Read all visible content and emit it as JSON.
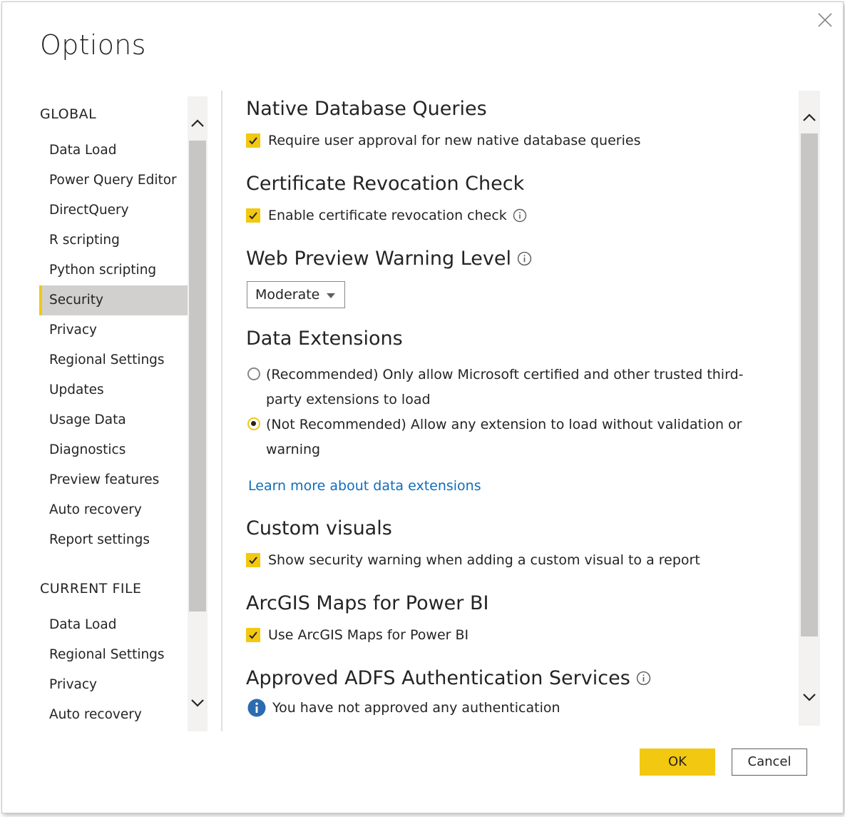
{
  "dialog": {
    "title": "Options",
    "ok_label": "OK",
    "cancel_label": "Cancel"
  },
  "nav": {
    "global_heading": "GLOBAL",
    "global_items": [
      {
        "label": "Data Load"
      },
      {
        "label": "Power Query Editor"
      },
      {
        "label": "DirectQuery"
      },
      {
        "label": "R scripting"
      },
      {
        "label": "Python scripting"
      },
      {
        "label": "Security",
        "selected": true
      },
      {
        "label": "Privacy"
      },
      {
        "label": "Regional Settings"
      },
      {
        "label": "Updates"
      },
      {
        "label": "Usage Data"
      },
      {
        "label": "Diagnostics"
      },
      {
        "label": "Preview features"
      },
      {
        "label": "Auto recovery"
      },
      {
        "label": "Report settings"
      }
    ],
    "current_heading": "CURRENT FILE",
    "current_items": [
      {
        "label": "Data Load"
      },
      {
        "label": "Regional Settings"
      },
      {
        "label": "Privacy"
      },
      {
        "label": "Auto recovery"
      }
    ]
  },
  "security": {
    "native_queries": {
      "title": "Native Database Queries",
      "checkbox_label": "Require user approval for new native database queries",
      "checked": true
    },
    "cert_revocation": {
      "title": "Certificate Revocation Check",
      "checkbox_label": "Enable certificate revocation check",
      "checked": true
    },
    "web_preview": {
      "title": "Web Preview Warning Level",
      "selected_value": "Moderate"
    },
    "data_extensions": {
      "title": "Data Extensions",
      "option_recommended_line1": "(Recommended) Only allow Microsoft certified and other trusted third-",
      "option_recommended_line2": "party extensions to load",
      "option_not_recommended_line1": "(Not Recommended) Allow any extension to load without validation or",
      "option_not_recommended_line2": "warning",
      "selected": "not_recommended",
      "learn_more": "Learn more about data extensions"
    },
    "custom_visuals": {
      "title": "Custom visuals",
      "checkbox_label": "Show security warning when adding a custom visual to a report",
      "checked": true
    },
    "arcgis": {
      "title": "ArcGIS Maps for Power BI",
      "checkbox_label": "Use ArcGIS Maps for Power BI",
      "checked": true
    },
    "adfs": {
      "title": "Approved ADFS Authentication Services",
      "message": "You have not approved any authentication"
    }
  },
  "colors": {
    "accent": "#f2c811",
    "selected_bg": "#d2d0ce",
    "link": "#0f6cbd",
    "info_blue": "#2b6cb0"
  }
}
